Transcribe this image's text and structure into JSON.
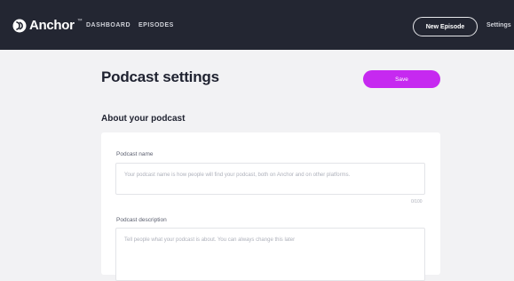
{
  "brand": {
    "name": "Anchor",
    "tm": "™"
  },
  "nav": {
    "dashboard": "DASHBOARD",
    "episodes": "EPISODES"
  },
  "header": {
    "new_episode": "New Episode",
    "settings": "Settings"
  },
  "page": {
    "title": "Podcast settings",
    "save": "Save"
  },
  "section": {
    "title": "About your podcast"
  },
  "fields": {
    "name": {
      "label": "Podcast name",
      "placeholder": "Your podcast name is how people will find your podcast, both on Anchor and on other platforms.",
      "counter": "0/100"
    },
    "description": {
      "label": "Podcast description",
      "placeholder": "Tell people what your podcast is about. You can always change this later"
    }
  },
  "colors": {
    "topbar": "#232632",
    "accent": "#c629f0",
    "background": "#f2f2f4"
  }
}
